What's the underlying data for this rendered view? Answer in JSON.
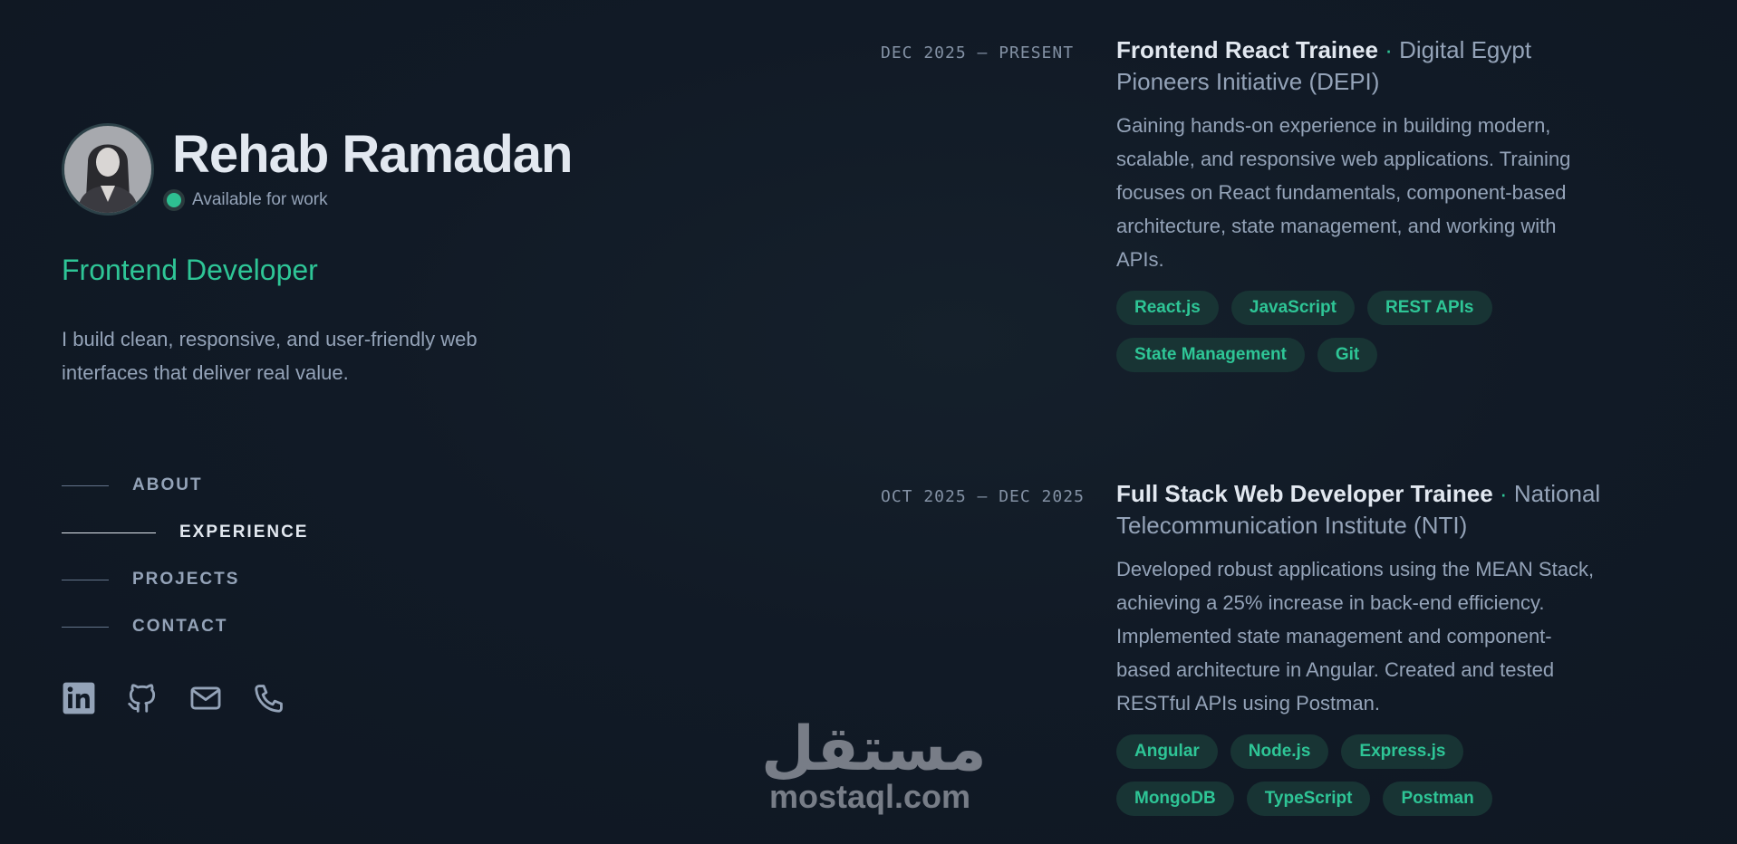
{
  "profile": {
    "name": "Rehab Ramadan",
    "status": "Available for work",
    "role": "Frontend Developer",
    "bio": "I build clean, responsive, and user-friendly web interfaces that deliver real value."
  },
  "nav": {
    "items": [
      {
        "label": "ABOUT",
        "active": false
      },
      {
        "label": "EXPERIENCE",
        "active": true
      },
      {
        "label": "PROJECTS",
        "active": false
      },
      {
        "label": "CONTACT",
        "active": false
      }
    ]
  },
  "socials": {
    "icons": [
      "linkedin-icon",
      "github-icon",
      "mail-icon",
      "phone-icon"
    ]
  },
  "experience": [
    {
      "date": "DEC 2025 — PRESENT",
      "role": "Frontend React Trainee",
      "separator": "·",
      "org": "Digital Egypt Pioneers Initiative (DEPI)",
      "description": "Gaining hands-on experience in building modern, scalable, and responsive web applications. Training focuses on React fundamentals, component-based architecture, state management, and working with APIs.",
      "tags": [
        "React.js",
        "JavaScript",
        "REST APIs",
        "State Management",
        "Git"
      ]
    },
    {
      "date": "OCT 2025 — DEC 2025",
      "role": "Full Stack Web Developer Trainee",
      "separator": "·",
      "org": "National Telecommunication Institute (NTI)",
      "description": "Developed robust applications using the MEAN Stack, achieving a 25% increase in back-end efficiency. Implemented state management and component-based architecture in Angular. Created and tested RESTful APIs using Postman.",
      "tags": [
        "Angular",
        "Node.js",
        "Express.js",
        "MongoDB",
        "TypeScript",
        "Postman"
      ]
    }
  ],
  "watermark": {
    "arabic": "مستقل",
    "url": "mostaql.com"
  },
  "colors": {
    "accent": "#2ec596",
    "background": "#111a26",
    "heading": "#e2e8f0",
    "text": "#94a3b8",
    "tag_bg": "#183434"
  }
}
